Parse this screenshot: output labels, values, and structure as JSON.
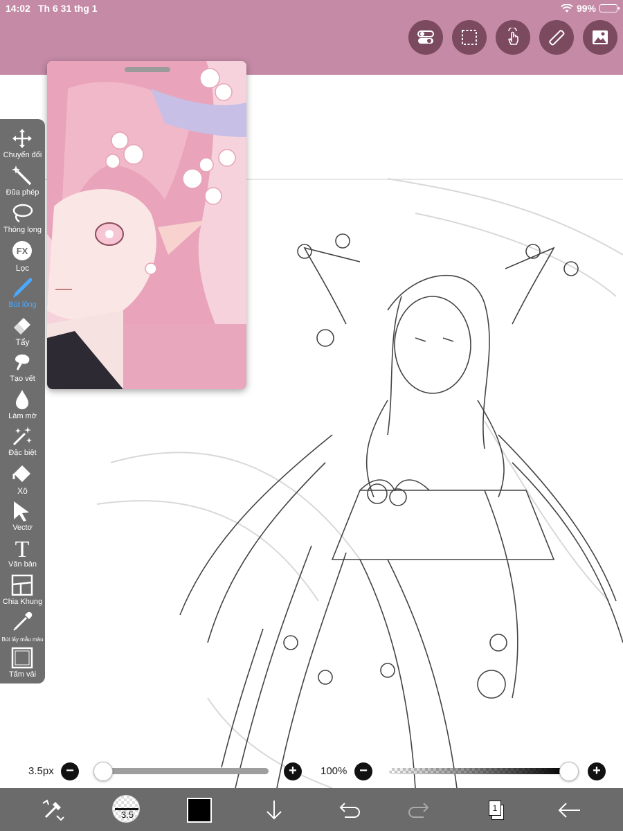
{
  "status": {
    "time": "14:02",
    "date": "Th 6 31 thg 1",
    "battery": "99%"
  },
  "top_actions": [
    {
      "icon": "toggle-icon"
    },
    {
      "icon": "selection-icon"
    },
    {
      "icon": "gesture-icon"
    },
    {
      "icon": "ruler-icon"
    },
    {
      "icon": "image-icon"
    }
  ],
  "reference_window": {
    "description_icon": "reference-image"
  },
  "toolbar": {
    "items": [
      {
        "label": "Chuyển đổi",
        "icon": "move-icon"
      },
      {
        "label": "Đũa phép",
        "icon": "magic-wand-icon"
      },
      {
        "label": "Thòng lọng",
        "icon": "lasso-icon"
      },
      {
        "label": "Lọc",
        "icon": "fx-icon"
      },
      {
        "label": "Bút lông",
        "icon": "brush-icon"
      },
      {
        "label": "Tẩy",
        "icon": "eraser-icon"
      },
      {
        "label": "Tạo vết",
        "icon": "smudge-icon"
      },
      {
        "label": "Làm mờ",
        "icon": "blur-icon"
      },
      {
        "label": "Đặc biệt",
        "icon": "special-icon"
      },
      {
        "label": "Xô",
        "icon": "bucket-icon"
      },
      {
        "label": "Vectơ",
        "icon": "vector-icon"
      },
      {
        "label": "Văn bản",
        "icon": "text-icon"
      },
      {
        "label": "Chia Khung",
        "icon": "frame-divider-icon"
      },
      {
        "label": "Bút lấy mẫu màu",
        "icon": "eyedropper-icon"
      },
      {
        "label": "Tấm vải",
        "icon": "canvas-icon"
      }
    ],
    "active_index": 4
  },
  "brush_slider": {
    "label": "3.5px",
    "value_fraction": 0.0
  },
  "opacity_slider": {
    "label": "100%",
    "value_fraction": 1.0
  },
  "bottom_bar": {
    "brush_size": "3.5",
    "color": "#000000",
    "layer_count": "1"
  },
  "colors": {
    "topbar": "#c48aa6",
    "toolbar": "#6e6e6e",
    "active_tool": "#4aa8ff",
    "bottombar": "#6b6b6b"
  }
}
